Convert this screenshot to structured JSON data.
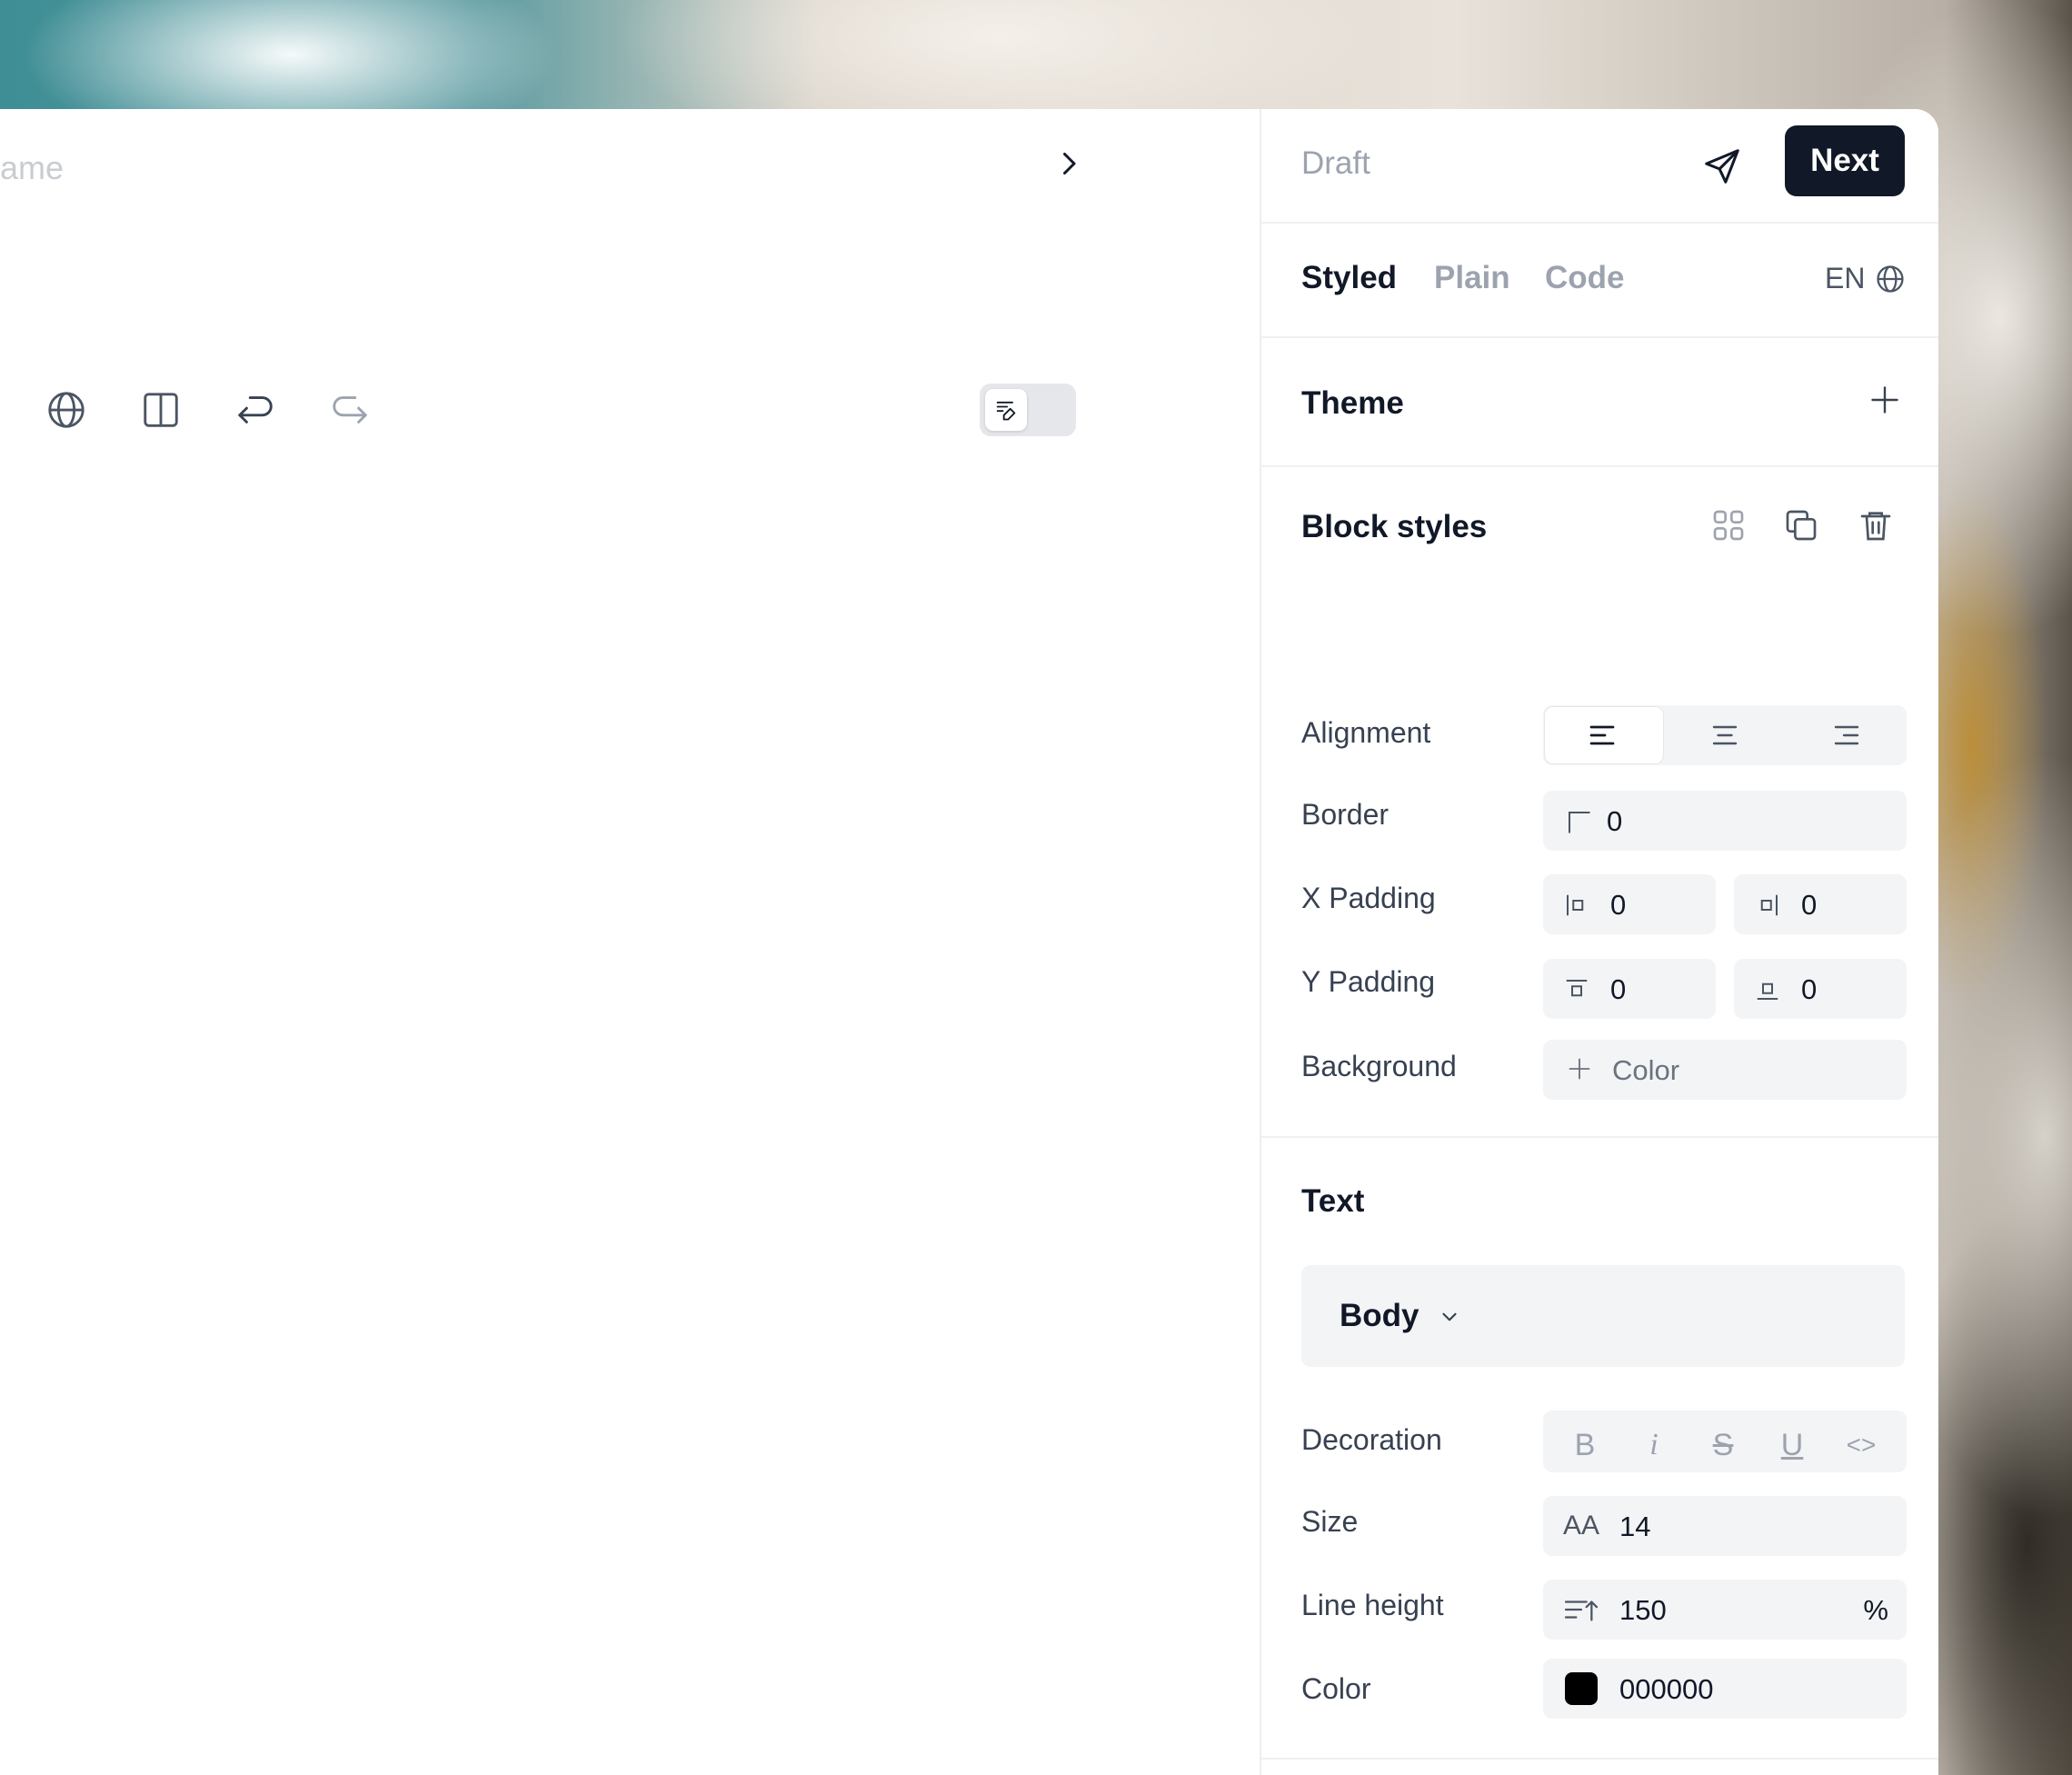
{
  "editor": {
    "name_placeholder": "ame",
    "toolbar": {
      "icons": [
        "globe-icon",
        "columns-icon",
        "undo-icon",
        "redo-icon"
      ]
    },
    "toggle": {
      "state": "on"
    }
  },
  "panel": {
    "status": "Draft",
    "next_label": "Next",
    "tabs": [
      {
        "label": "Styled",
        "active": true
      },
      {
        "label": "Plain",
        "active": false
      },
      {
        "label": "Code",
        "active": false
      }
    ],
    "language": "EN",
    "theme": {
      "title": "Theme"
    },
    "block_styles": {
      "title": "Block styles",
      "alignment": {
        "label": "Alignment",
        "options": [
          "left",
          "center",
          "right"
        ],
        "selected": "left"
      },
      "border": {
        "label": "Border",
        "value": "0"
      },
      "x_padding": {
        "label": "X Padding",
        "left": "0",
        "right": "0"
      },
      "y_padding": {
        "label": "Y Padding",
        "top": "0",
        "bottom": "0"
      },
      "background": {
        "label": "Background",
        "placeholder": "Color"
      }
    },
    "text": {
      "title": "Text",
      "style_select": "Body",
      "decoration": {
        "label": "Decoration",
        "bold": "B",
        "italic": "i",
        "strike": "S",
        "underline": "U",
        "code": "<>"
      },
      "size": {
        "label": "Size",
        "value": "14",
        "icon_text": "AA"
      },
      "line_height": {
        "label": "Line height",
        "value": "150",
        "unit": "%"
      },
      "color": {
        "label": "Color",
        "value": "000000",
        "swatch": "#000000"
      }
    }
  },
  "colors": {
    "primary": "#111827",
    "muted": "#9ca3af",
    "field_bg": "#f3f4f6"
  }
}
